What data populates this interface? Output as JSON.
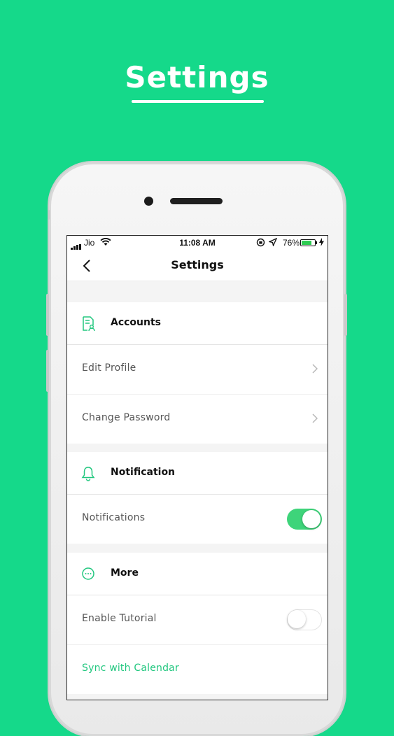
{
  "promo": {
    "title": "Settings"
  },
  "status_bar": {
    "carrier": "Jio",
    "time": "11:08 AM",
    "battery_percent": "76%",
    "battery_level": 0.76
  },
  "nav": {
    "title": "Settings",
    "back_icon": "chevron-left-icon"
  },
  "sections": [
    {
      "header": "Accounts",
      "icon": "account-document-icon",
      "items": [
        {
          "label": "Edit Profile",
          "control": "chevron"
        },
        {
          "label": "Change Password",
          "control": "chevron"
        }
      ]
    },
    {
      "header": "Notification",
      "icon": "bell-icon",
      "items": [
        {
          "label": "Notifications",
          "control": "toggle",
          "on": true
        }
      ]
    },
    {
      "header": "More",
      "icon": "more-circle-icon",
      "items": [
        {
          "label": "Enable Tutorial",
          "control": "toggle",
          "on": false
        },
        {
          "label": "Sync with Calendar",
          "control": "link"
        }
      ]
    }
  ],
  "colors": {
    "background": "#15d98a",
    "accent": "#22c77f",
    "toggle_on": "#3ed47a"
  }
}
